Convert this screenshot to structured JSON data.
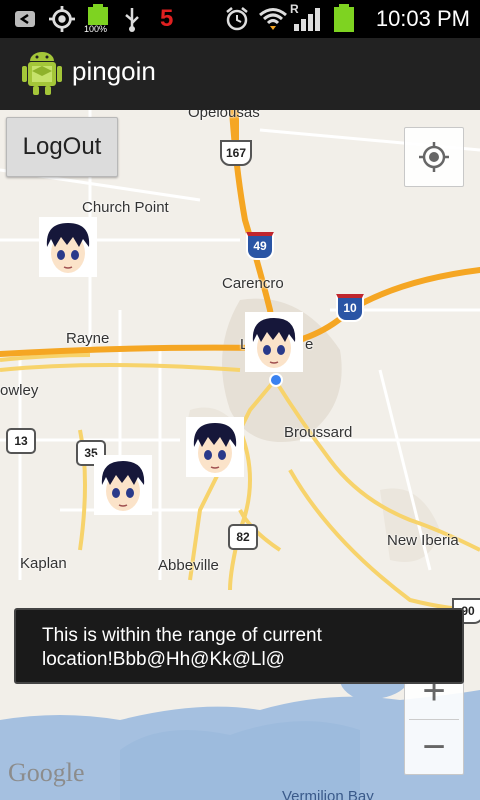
{
  "status_bar": {
    "time": "10:03 PM",
    "battery_percent_label": "100%",
    "notification_count": "5",
    "signal_label": "R",
    "icons": [
      "back-notification-icon",
      "gps-icon",
      "battery-full-icon",
      "usb-icon",
      "alarm-icon",
      "wifi-icon",
      "cell-signal-icon",
      "battery-icon"
    ]
  },
  "action_bar": {
    "title": "pingoin",
    "icon": "android-app-icon"
  },
  "map": {
    "logout_label": "LogOut",
    "my_location_icon": "crosshair-icon",
    "zoom_in_label": "+",
    "zoom_out_label": "−",
    "attribution": "Google",
    "places": {
      "opelousas": "Opelousas",
      "church_point": "Church Point",
      "carencro": "Carencro",
      "rayne": "Rayne",
      "crowley": "owley",
      "lafayette": "L",
      "lafayette_tail": "e",
      "broussard": "Broussard",
      "new_iberia": "New Iberia",
      "kaplan": "Kaplan",
      "abbeville": "Abbeville",
      "vermilion_bay": "Vermilion Bay"
    },
    "route_shields": {
      "us167": "167",
      "i49": "49",
      "i10": "10",
      "la13": "13",
      "la35": "35",
      "la82": "82",
      "us90": "90"
    },
    "markers": [
      "avatar-marker",
      "avatar-marker",
      "avatar-marker",
      "avatar-marker"
    ],
    "colors": {
      "land": "#f2efe9",
      "water": "#a5c0e0",
      "highway": "#f5a623",
      "major_road": "#f7d36b",
      "minor_road": "#ffffff",
      "urban": "#e6e0d6",
      "location_dot": "#3a82f0"
    }
  },
  "toast": {
    "line1": "This is within the range of current",
    "line2": "location!Bbb@Hh@Kk@Ll@"
  }
}
